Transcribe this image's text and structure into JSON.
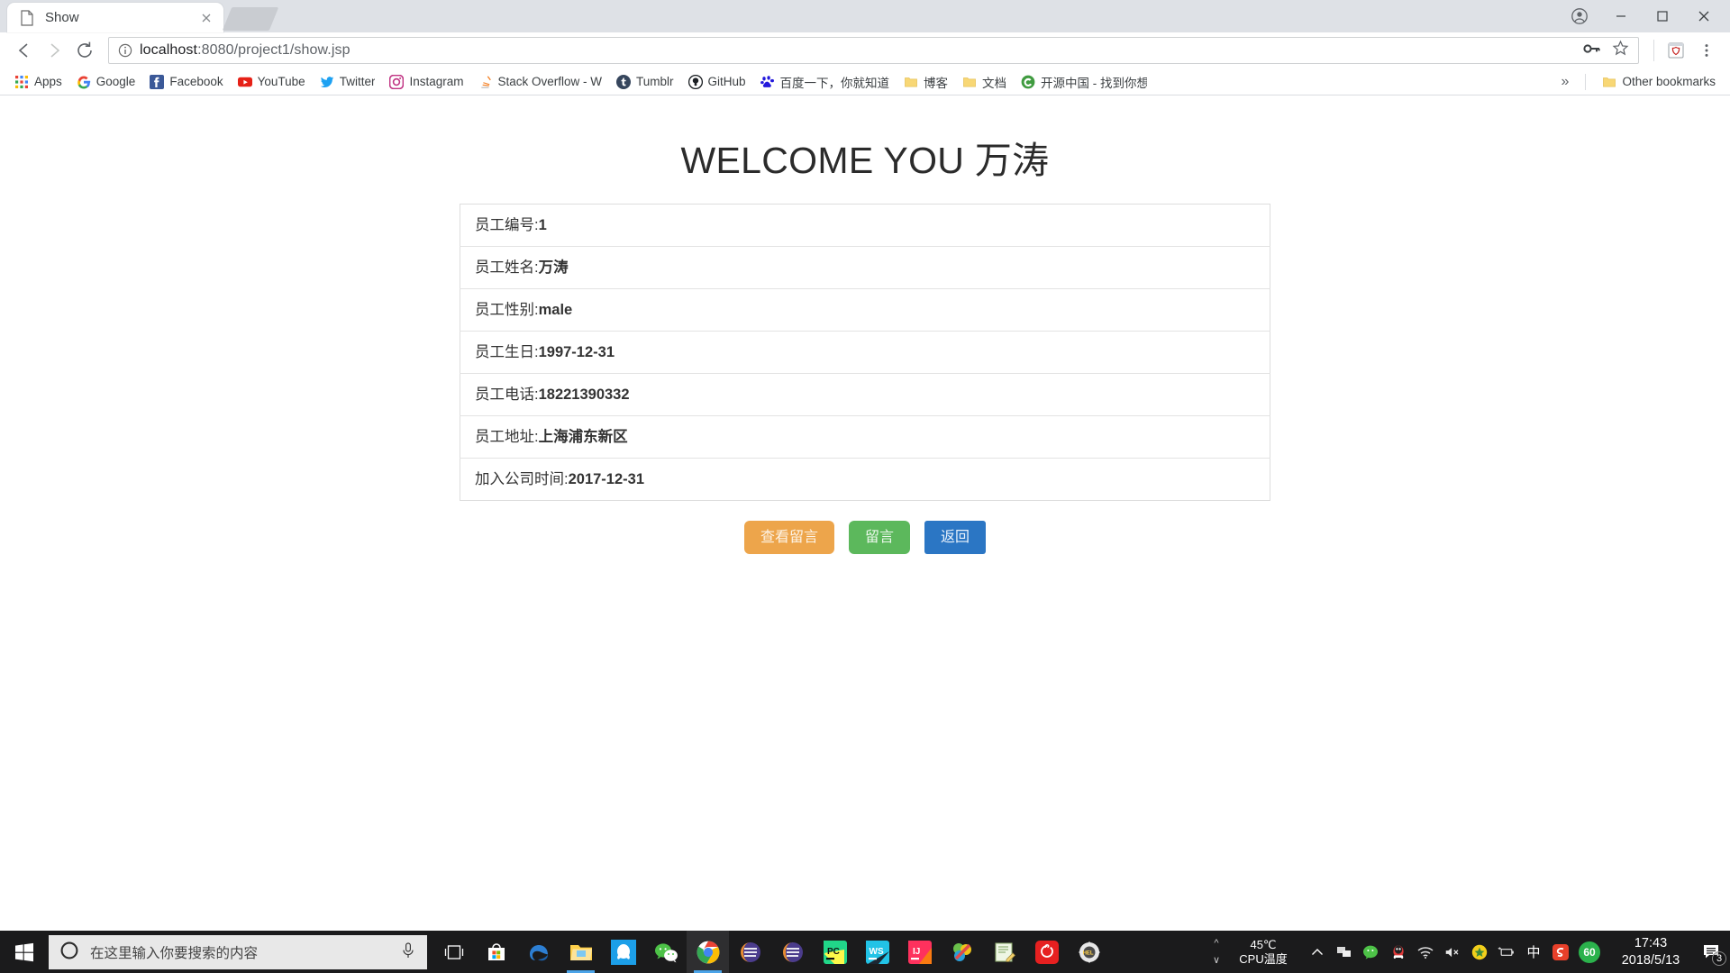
{
  "browser": {
    "tab": {
      "title": "Show",
      "favicon": "document-icon",
      "close": "close-icon"
    },
    "nav": {
      "back": "back-arrow-icon",
      "forward": "forward-arrow-icon",
      "reload": "reload-icon"
    },
    "omnibox": {
      "info_icon": "info-circle-icon",
      "host": "localhost",
      "rest": ":8080/project1/show.jsp",
      "full_url": "localhost:8080/project1/show.jsp",
      "password_icon": "key-icon",
      "bookmark_icon": "star-icon",
      "extension_icon": "shield-extension-icon",
      "menu_icon": "three-dot-menu-icon"
    },
    "window_controls": {
      "account": "account-icon",
      "minimize": "minimize-icon",
      "maximize": "maximize-icon",
      "close": "close-icon"
    },
    "bookmarks": [
      {
        "label": "Apps",
        "icon": "apps-grid-icon"
      },
      {
        "label": "Google",
        "icon": "google-icon"
      },
      {
        "label": "Facebook",
        "icon": "facebook-icon"
      },
      {
        "label": "YouTube",
        "icon": "youtube-icon"
      },
      {
        "label": "Twitter",
        "icon": "twitter-icon"
      },
      {
        "label": "Instagram",
        "icon": "instagram-icon"
      },
      {
        "label": "Stack Overflow - W",
        "icon": "stackoverflow-icon"
      },
      {
        "label": "Tumblr",
        "icon": "tumblr-icon"
      },
      {
        "label": "GitHub",
        "icon": "github-icon"
      },
      {
        "label": "百度一下，你就知道",
        "icon": "baidu-icon"
      },
      {
        "label": "博客",
        "icon": "folder-icon"
      },
      {
        "label": "文档",
        "icon": "folder-icon"
      },
      {
        "label": "开源中国 - 找到你想",
        "icon": "oschina-icon"
      }
    ],
    "bookmarks_overflow": "»",
    "other_bookmarks": {
      "label": "Other bookmarks",
      "icon": "folder-icon"
    }
  },
  "page": {
    "heading": "WELCOME YOU 万涛",
    "rows": [
      {
        "label": "员工编号:",
        "value": "1"
      },
      {
        "label": "员工姓名:",
        "value": "万涛"
      },
      {
        "label": "员工性别:",
        "value": "male"
      },
      {
        "label": "员工生日:",
        "value": "1997-12-31"
      },
      {
        "label": "员工电话:",
        "value": "18221390332"
      },
      {
        "label": "员工地址:",
        "value": "上海浦东新区"
      },
      {
        "label": "加入公司时间:",
        "value": "2017-12-31"
      }
    ],
    "buttons": [
      {
        "label": "查看留言",
        "color": "#eda54b"
      },
      {
        "label": "留言",
        "color": "#5cb85c"
      },
      {
        "label": "返回",
        "color": "#2b76c4"
      }
    ]
  },
  "taskbar": {
    "start_icon": "windows-start-icon",
    "search": {
      "icon": "cortana-circle-icon",
      "placeholder": "在这里输入你要搜索的内容",
      "mic_icon": "microphone-icon"
    },
    "pinned": [
      {
        "name": "task-view-icon",
        "label": "Task View"
      },
      {
        "name": "microsoft-store-icon",
        "label": "Microsoft Store"
      },
      {
        "name": "edge-icon",
        "label": "Microsoft Edge"
      },
      {
        "name": "file-explorer-icon",
        "label": "File Explorer"
      },
      {
        "name": "qq-icon",
        "label": "QQ"
      },
      {
        "name": "wechat-icon",
        "label": "WeChat"
      },
      {
        "name": "chrome-icon",
        "label": "Google Chrome"
      },
      {
        "name": "eclipse-icon",
        "label": "Eclipse"
      },
      {
        "name": "eclipse-icon-2",
        "label": "Eclipse"
      },
      {
        "name": "pycharm-icon",
        "label": "PyCharm"
      },
      {
        "name": "webstorm-icon",
        "label": "WebStorm"
      },
      {
        "name": "intellij-idea-icon",
        "label": "IntelliJ IDEA"
      },
      {
        "name": "navicat-icon",
        "label": "Navicat"
      },
      {
        "name": "notepad-icon",
        "label": "Editor"
      },
      {
        "name": "netease-music-icon",
        "label": "NetEase Cloud Music"
      },
      {
        "name": "gear-tool-icon",
        "label": "Tool"
      }
    ],
    "cpu": {
      "temperature": "45℃",
      "label": "CPU温度"
    },
    "tray": [
      {
        "name": "show-hidden-icons-chevron",
        "glyph": "^"
      },
      {
        "name": "onedrive-icon",
        "glyph": ""
      },
      {
        "name": "wechat-tray-icon",
        "glyph": ""
      },
      {
        "name": "qq-penguin-icon",
        "glyph": ""
      },
      {
        "name": "wifi-icon",
        "glyph": ""
      },
      {
        "name": "volume-muted-icon",
        "glyph": ""
      },
      {
        "name": "security-icon",
        "glyph": ""
      },
      {
        "name": "battery-icon",
        "glyph": ""
      },
      {
        "name": "ime-chinese-icon",
        "glyph": "中"
      },
      {
        "name": "sogou-input-icon",
        "glyph": "S"
      },
      {
        "name": "driver-score-icon",
        "glyph": "60"
      }
    ],
    "clock": {
      "time": "17:43",
      "date": "2018/5/13"
    },
    "notifications": {
      "icon": "action-center-icon",
      "count": "3"
    }
  }
}
